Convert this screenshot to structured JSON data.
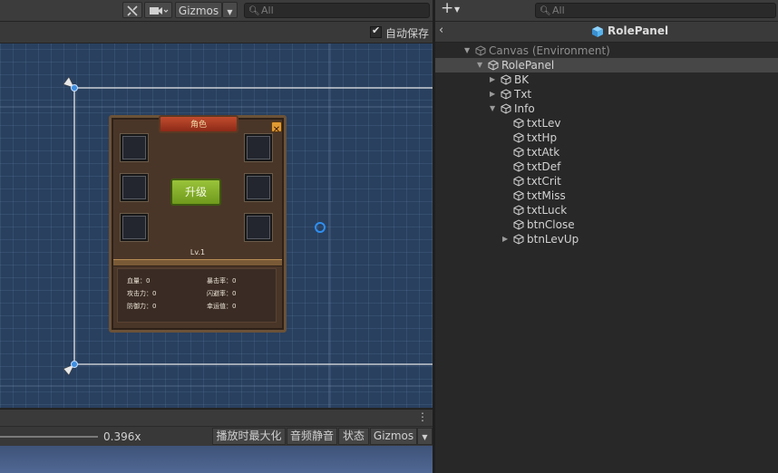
{
  "scene_toolbar": {
    "gizmos_label": "Gizmos",
    "search_placeholder": "All"
  },
  "scene_subbar": {
    "autosave_label": "自动保存",
    "autosave_checked": true
  },
  "role_panel": {
    "title": "角色",
    "upgrade_label": "升级",
    "level_text": "Lv.1",
    "stats": [
      {
        "label": "血量：0"
      },
      {
        "label": "暴击率：0"
      },
      {
        "label": "攻击力：0"
      },
      {
        "label": "闪避率：0"
      },
      {
        "label": "防御力：0"
      },
      {
        "label": "幸运值：0"
      }
    ]
  },
  "game_toolbar": {
    "scale_value": "0.396x",
    "maximize_label": "播放时最大化",
    "mute_label": "音频静音",
    "stats_label": "状态",
    "gizmos_label": "Gizmos"
  },
  "hierarchy": {
    "search_placeholder": "All",
    "title": "RolePanel",
    "rows": [
      {
        "label": "Canvas (Environment)",
        "depth": 0,
        "expanded": true,
        "has_children": true,
        "dim": true
      },
      {
        "label": "RolePanel",
        "depth": 1,
        "expanded": true,
        "has_children": true,
        "selected": true
      },
      {
        "label": "BK",
        "depth": 2,
        "expanded": false,
        "has_children": true
      },
      {
        "label": "Txt",
        "depth": 2,
        "expanded": false,
        "has_children": true
      },
      {
        "label": "Info",
        "depth": 2,
        "expanded": true,
        "has_children": true
      },
      {
        "label": "txtLev",
        "depth": 3,
        "has_children": false
      },
      {
        "label": "txtHp",
        "depth": 3,
        "has_children": false
      },
      {
        "label": "txtAtk",
        "depth": 3,
        "has_children": false
      },
      {
        "label": "txtDef",
        "depth": 3,
        "has_children": false
      },
      {
        "label": "txtCrit",
        "depth": 3,
        "has_children": false
      },
      {
        "label": "txtMiss",
        "depth": 3,
        "has_children": false
      },
      {
        "label": "txtLuck",
        "depth": 3,
        "has_children": false
      },
      {
        "label": "btnClose",
        "depth": 3,
        "has_children": false
      },
      {
        "label": "btnLevUp",
        "depth": 3,
        "expanded": false,
        "has_children": true
      }
    ]
  },
  "colors": {
    "scene_bg": "#29405f",
    "upgrade_green": "#7fa826",
    "title_red": "#a23a22",
    "close_orange": "#e2a23a",
    "cube_blue": "#57b4ee"
  }
}
